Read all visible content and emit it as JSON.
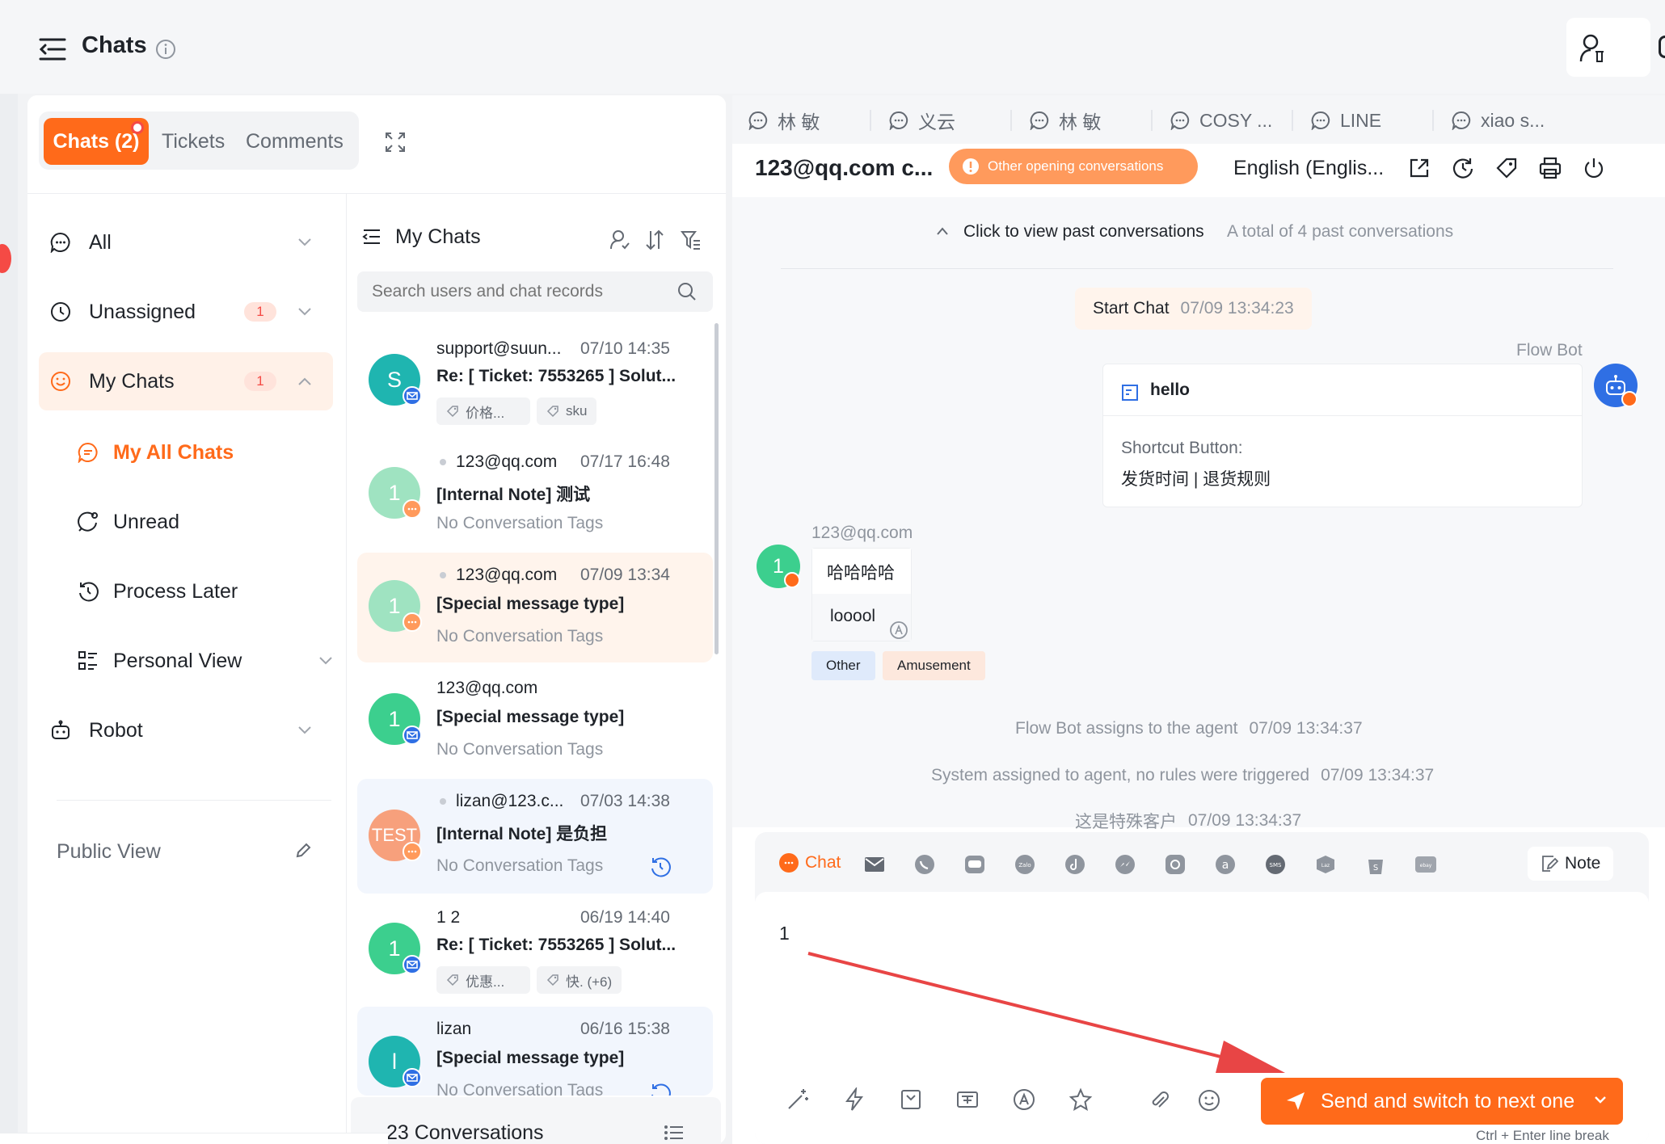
{
  "header": {
    "title": "Chats"
  },
  "tabs": {
    "chats": "Chats (2)",
    "tickets": "Tickets",
    "comments": "Comments"
  },
  "nav": {
    "all": "All",
    "unassigned": "Unassigned",
    "unassigned_count": "1",
    "my_chats": "My Chats",
    "my_chats_count": "1",
    "my_all_chats": "My All Chats",
    "unread": "Unread",
    "process_later": "Process Later",
    "personal_view": "Personal View",
    "robot": "Robot",
    "public_view": "Public View"
  },
  "list": {
    "title": "My Chats",
    "search_placeholder": "Search users and chat records",
    "footer": "23 Conversations",
    "items": [
      {
        "avatar": "S",
        "name": "support@suun...",
        "time": "07/10 14:35",
        "msg": "Re: [ Ticket: 7553265 ] Solut...",
        "tag1": "价格...",
        "tag2": "sku"
      },
      {
        "avatar": "1",
        "name": "123@qq.com",
        "time": "07/17 16:48",
        "msg": "[Internal Note] 测试",
        "tags": "No Conversation Tags"
      },
      {
        "avatar": "1",
        "name": "123@qq.com",
        "time": "07/09 13:34",
        "msg": "[Special message type]",
        "tags": "No Conversation Tags"
      },
      {
        "avatar": "1",
        "name": "123@qq.com",
        "time": "",
        "msg": "[Special message type]",
        "tags": "No Conversation Tags"
      },
      {
        "avatar": "TEST",
        "name": "lizan@123.c...",
        "time": "07/03 14:38",
        "msg": "[Internal Note] 是负担",
        "tags": "No Conversation Tags"
      },
      {
        "avatar": "1",
        "name": "1 2",
        "time": "06/19 14:40",
        "msg": "Re: [ Ticket: 7553265 ] Solut...",
        "tag1": "优惠...",
        "tag2": "快. (+6)"
      },
      {
        "avatar": "l",
        "name": "lizan",
        "time": "06/16 15:38",
        "msg": "[Special message type]",
        "tags": "No Conversation Tags"
      }
    ]
  },
  "conv_tabs": [
    "林 敏",
    "义云",
    "林 敏",
    "COSY ...",
    "LINE",
    "xiao s..."
  ],
  "conversation": {
    "contact": "123@qq.com c...",
    "other_opening": "Other opening conversations",
    "language": "English (Englis...",
    "past_link": "Click to view past conversations",
    "past_total": "A total of 4 past conversations",
    "start_chat": "Start Chat",
    "start_time": "07/09 13:34:23",
    "bot_name": "Flow Bot",
    "bot_card_title": "hello",
    "shortcut_label": "Shortcut Button:",
    "shortcut_value": "发货时间 | 退货规则",
    "user_name": "123@qq.com",
    "msg1": "哈哈哈哈",
    "msg2": "looool",
    "tag_other": "Other",
    "tag_amusement": "Amusement",
    "sys1": "Flow Bot assigns to the agent",
    "sys1_time": "07/09 13:34:37",
    "sys2": "System assigned to agent, no rules were triggered",
    "sys2_time": "07/09 13:34:37",
    "sys3": "这是特殊客户",
    "sys3_time": "07/09 13:34:37"
  },
  "composer": {
    "chat_tab": "Chat",
    "note_btn": "Note",
    "input_value": "1",
    "send_label": "Send and switch to next one",
    "hint": "Ctrl + Enter line break"
  },
  "colors": {
    "accent": "#ff6a1a",
    "teal": "#1fb5b0",
    "green": "#3ccf8e",
    "blue": "#2f6fe4"
  }
}
